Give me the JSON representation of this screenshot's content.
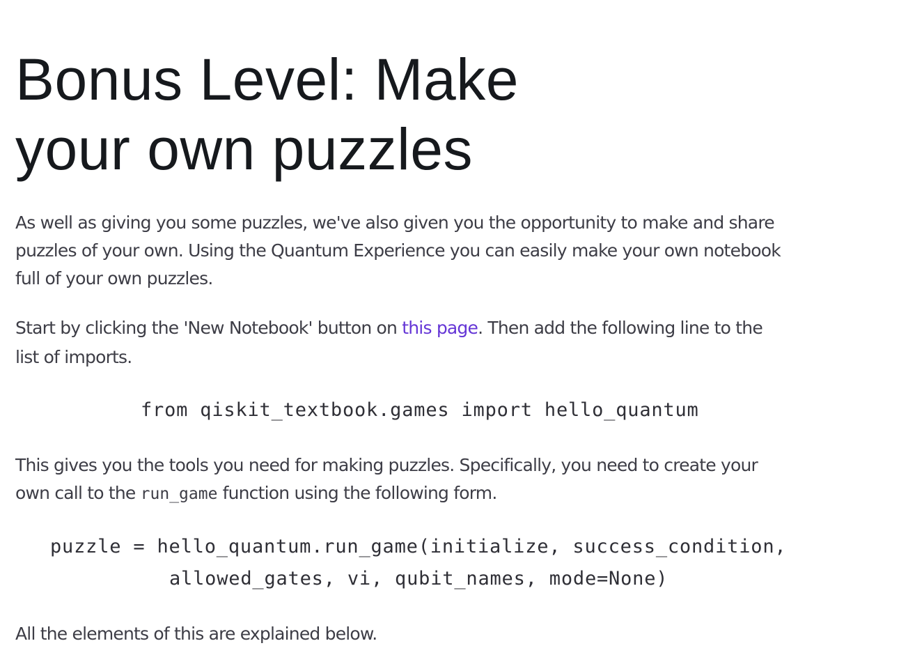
{
  "heading": {
    "line1": "Bonus Level: Make",
    "line2": "your own puzzles"
  },
  "paragraph1": {
    "line1": "As well as giving you some puzzles, we've also given you the opportunity to make and share",
    "line2": "puzzles of your own. Using the Quantum Experience you can easily make your own notebook",
    "line3": "full of your own puzzles."
  },
  "paragraph2": {
    "before_link": "Start by clicking the 'New Notebook' button on ",
    "link_text": "this page",
    "after_link": ". Then add the following line to the",
    "line2": "list of imports."
  },
  "code_import": "from qiskit_textbook.games import hello_quantum",
  "paragraph3": {
    "line1": "This gives you the tools you need for making puzzles. Specifically, you need to create your",
    "line2_before": "own call to the ",
    "inline_code": "run_game",
    "line2_after": " function using the following form."
  },
  "code_call": {
    "line1": "puzzle = hello_quantum.run_game(initialize, success_condition,",
    "line2": "allowed_gates, vi, qubit_names, mode=None)"
  },
  "paragraph4": "All the elements of this are explained below.",
  "colors": {
    "heading": "#16191d",
    "body_text": "#3d3d46",
    "link": "#6536d6",
    "background": "#ffffff"
  }
}
